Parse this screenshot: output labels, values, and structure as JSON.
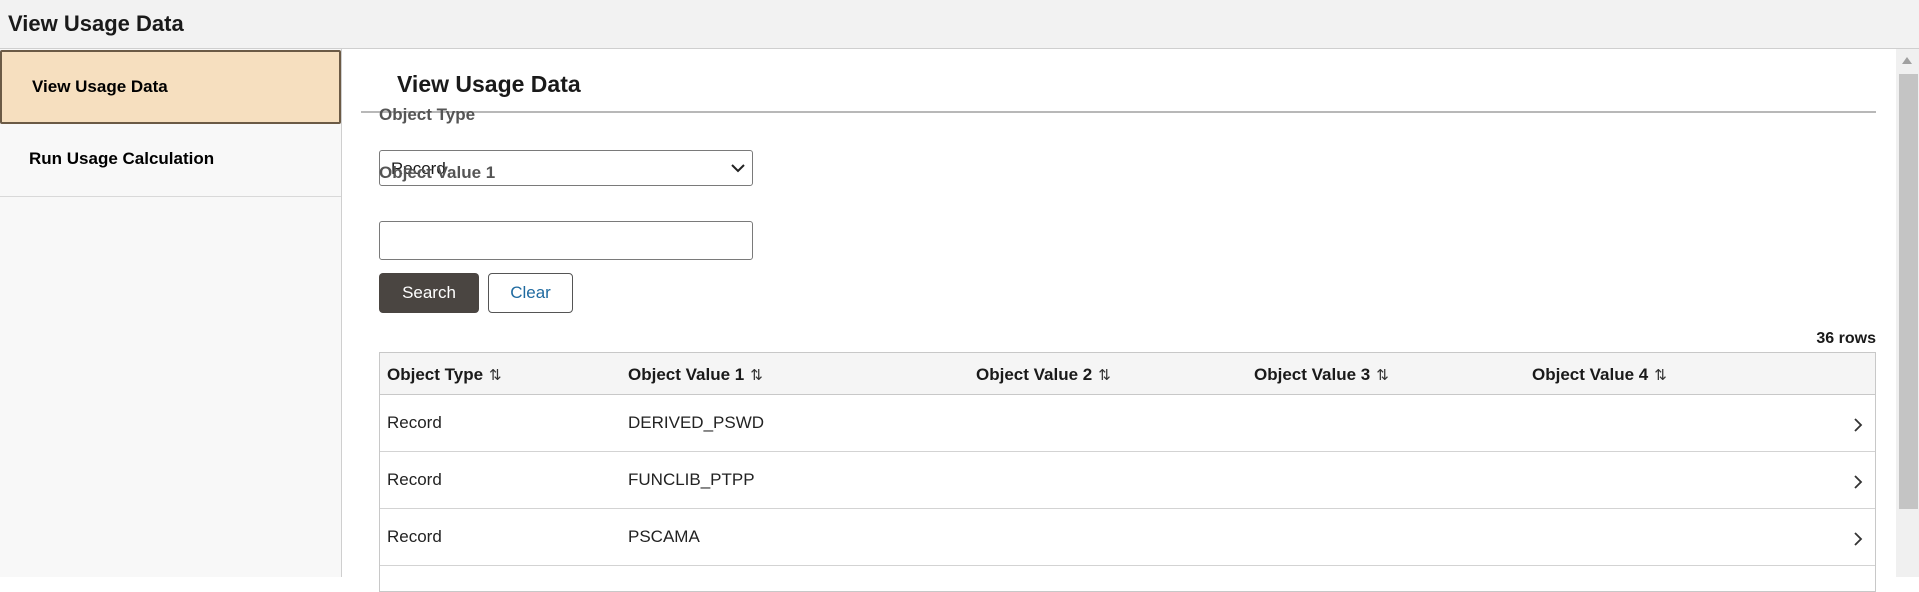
{
  "header": {
    "title": "View Usage Data"
  },
  "sidebar": {
    "items": [
      {
        "label": "View Usage Data",
        "active": true
      },
      {
        "label": "Run Usage Calculation",
        "active": false
      }
    ]
  },
  "main": {
    "title": "View Usage Data",
    "object_type_label": "Object Type",
    "object_type_value": "Record",
    "object_value1_label": "Object Value 1",
    "object_value1_value": "",
    "search_label": "Search",
    "clear_label": "Clear",
    "row_count": "36 rows",
    "columns": [
      "Object Type",
      "Object Value 1",
      "Object Value 2",
      "Object Value 3",
      "Object Value 4"
    ],
    "rows": [
      [
        "Record",
        "DERIVED_PSWD",
        "",
        "",
        ""
      ],
      [
        "Record",
        "FUNCLIB_PTPP",
        "",
        "",
        ""
      ],
      [
        "Record",
        "PSCAMA",
        "",
        "",
        ""
      ]
    ]
  },
  "colors": {
    "active_nav_bg": "#f6dfbf",
    "search_button_bg": "#4a4541",
    "clear_button_text": "#1f6aa0"
  },
  "icons": {
    "select_caret": "chevron-down-icon",
    "sort": "sort-icon",
    "row_nav": "chevron-right-icon"
  }
}
